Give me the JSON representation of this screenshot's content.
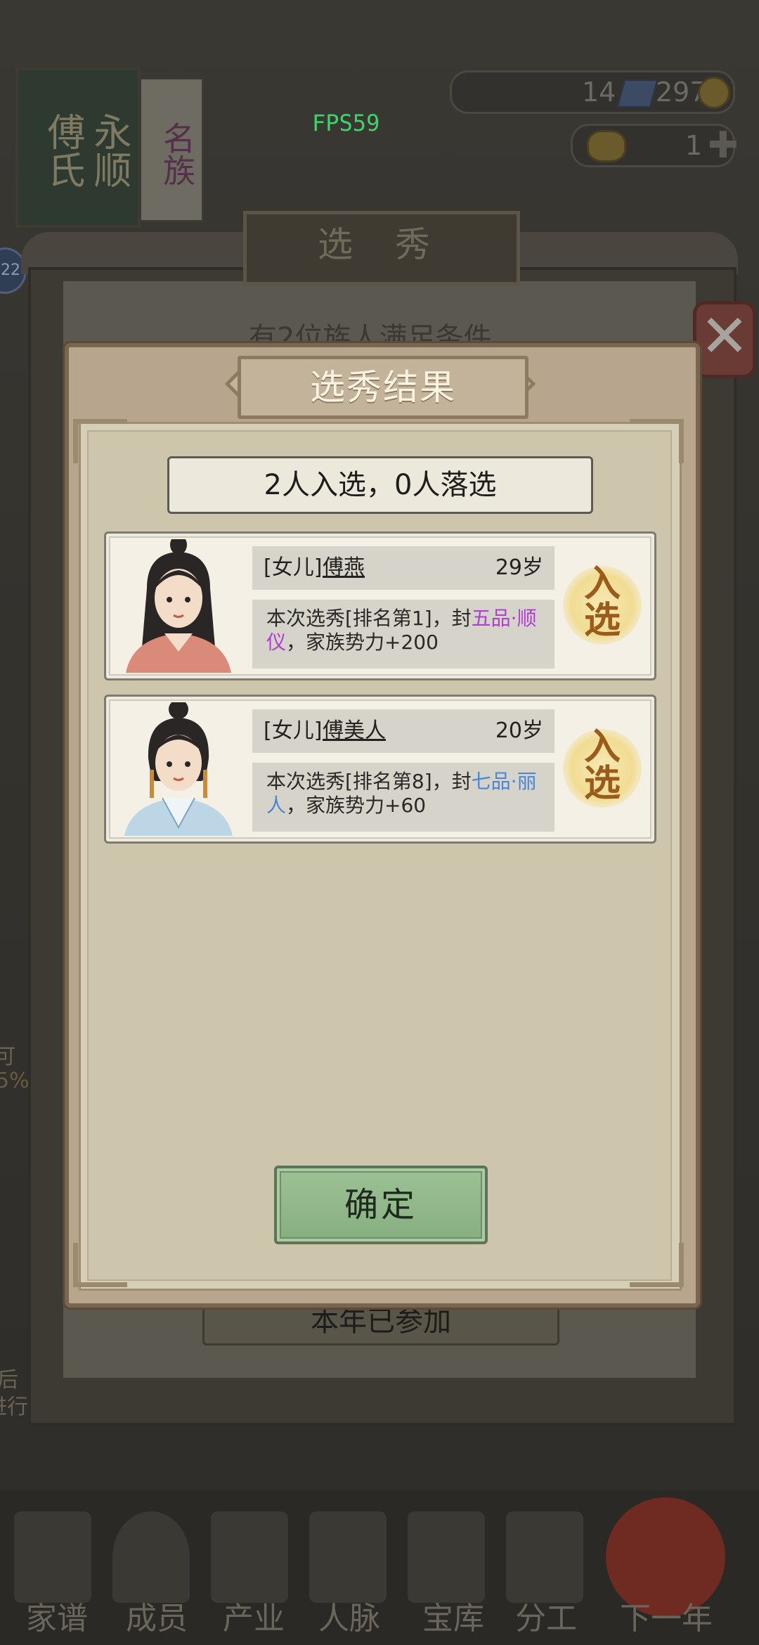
{
  "hud": {
    "fps": "FPS59",
    "resource_gems": "14",
    "resource_coins": "297",
    "resource_second": "1",
    "plus_icon": "plus-icon",
    "level_badge": "22"
  },
  "background": {
    "banner_text": "永顺 傅氏",
    "scroll_text": "名族",
    "board_title": "选 秀",
    "condition_text": "有2位族人满足条件",
    "participated_button": "本年已参加",
    "side_left_texts": [
      "可",
      "5%",
      "后",
      "进行"
    ],
    "close_icon": "close-icon"
  },
  "nav": {
    "items": [
      "家谱",
      "成员",
      "产业",
      "人脉",
      "宝库",
      "分工",
      "下一年"
    ]
  },
  "modal": {
    "title": "选秀结果",
    "summary": "2人入选，0人落选",
    "confirm_label": "确定",
    "entries": [
      {
        "relation": "[女儿]",
        "name": "傅燕",
        "age": "29岁",
        "desc_prefix": "本次选秀[排名第1]，封",
        "rank_title": "五品·顺仪",
        "desc_suffix": "，家族势力+200",
        "highlight_color": "#b03fd0",
        "stamp_line1": "入",
        "stamp_line2": "选"
      },
      {
        "relation": "[女儿]",
        "name": "傅美人",
        "age": "20岁",
        "desc_prefix": "本次选秀[排名第8]，封",
        "rank_title": "七品·丽人",
        "desc_suffix": "，家族势力+60",
        "highlight_color": "#4a86d8",
        "stamp_line1": "入",
        "stamp_line2": "选"
      }
    ]
  }
}
